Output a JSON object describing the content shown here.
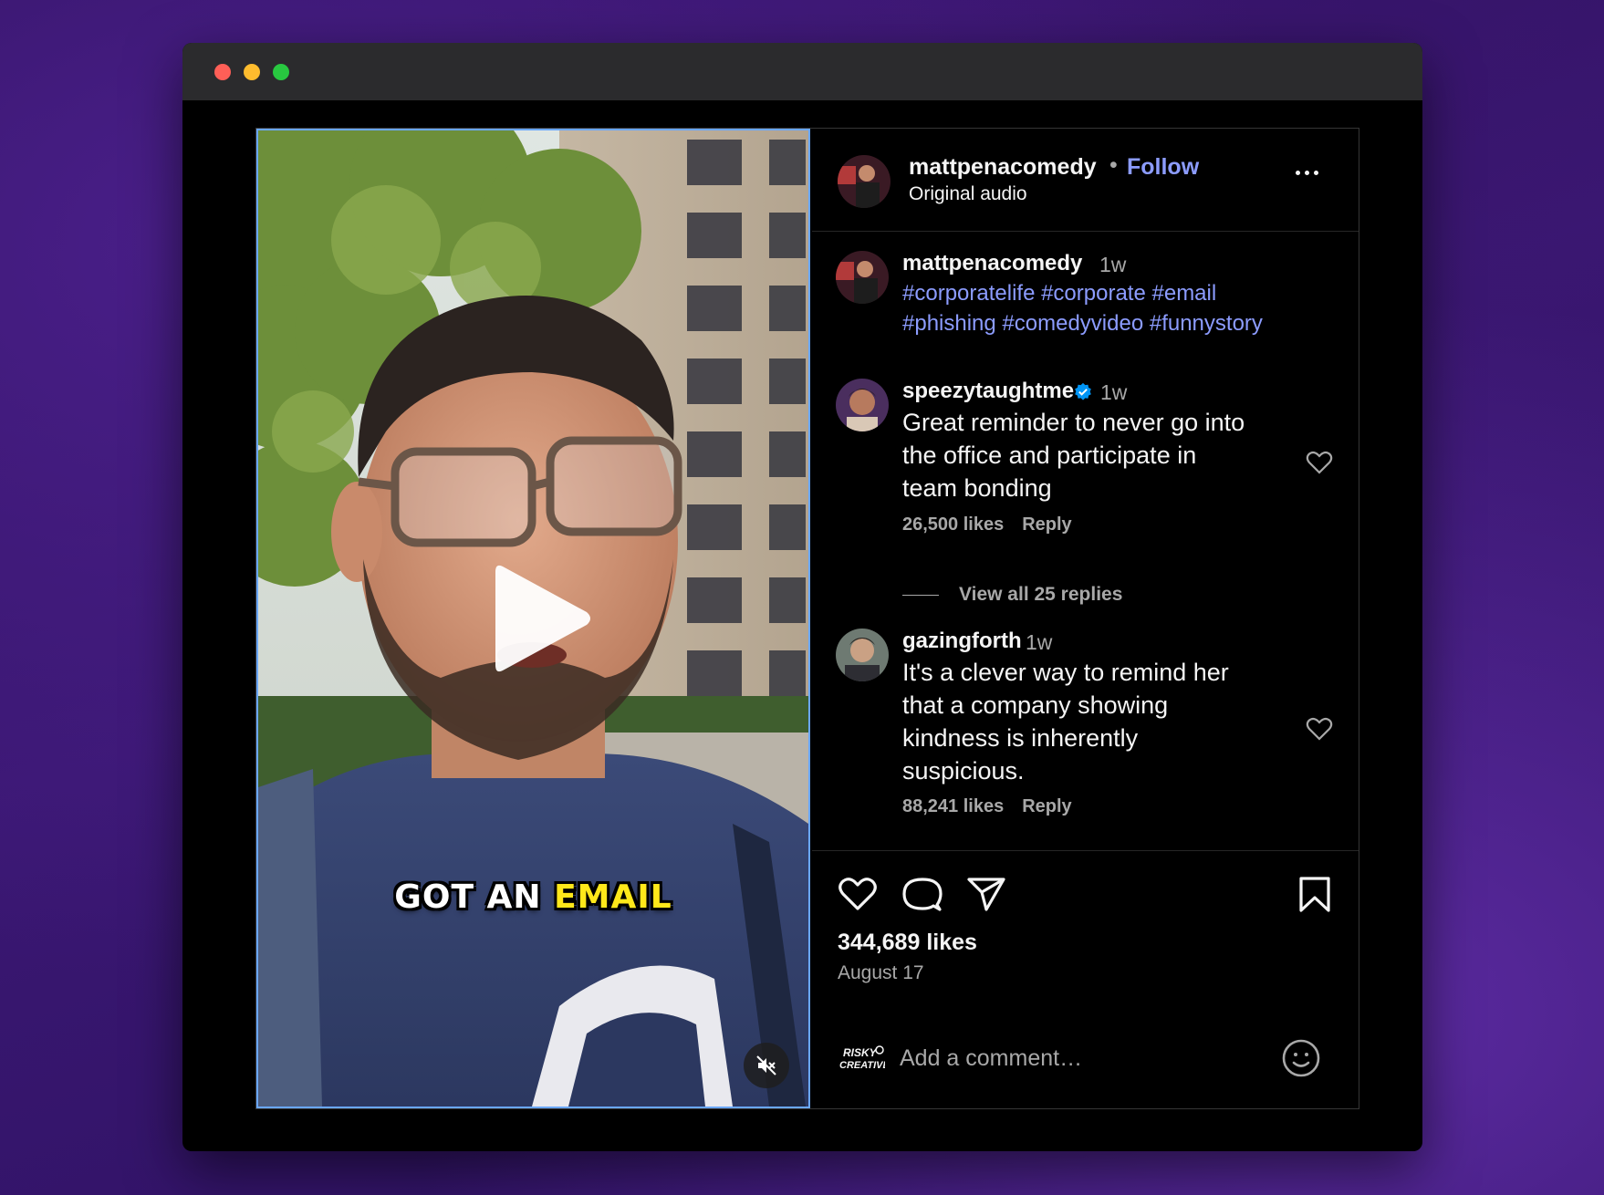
{
  "window": {
    "controls": [
      "close",
      "minimize",
      "maximize"
    ]
  },
  "video": {
    "caption_part1": "GOT AN ",
    "caption_part2": "EMAIL",
    "play_icon": "play-icon",
    "mute_icon": "mute-icon"
  },
  "header": {
    "username": "mattpenacomedy",
    "separator": "•",
    "follow_label": "Follow",
    "audio_label": "Original audio",
    "more_icon": "more-options-icon"
  },
  "caption_comment": {
    "username": "mattpenacomedy",
    "time": "1w",
    "hashtags_line1": "#corporatelife #corporate #email",
    "hashtags_line2": "#phishing #comedyvideo #funnystory"
  },
  "comments": [
    {
      "username": "speezytaughtme",
      "verified": true,
      "time": "1w",
      "text_lines": [
        "Great reminder to never go into",
        "the office and participate in",
        "team bonding"
      ],
      "likes": "26,500 likes",
      "reply_label": "Reply",
      "view_replies": "View all 25 replies"
    },
    {
      "username": "gazingforth",
      "verified": false,
      "time": "1w",
      "text_lines": [
        "It's a clever way to remind her",
        "that a company showing",
        "kindness is inherently",
        "suspicious."
      ],
      "likes": "88,241 likes",
      "reply_label": "Reply"
    }
  ],
  "actions": {
    "icons": [
      "heart-icon",
      "comment-icon",
      "share-icon",
      "bookmark-icon"
    ],
    "likes": "344,689 likes",
    "date": "August 17"
  },
  "add_comment": {
    "avatar_text_line1": "RISKY",
    "avatar_text_line2": "CREATIVE",
    "placeholder": "Add a comment…",
    "emoji_icon": "emoji-icon"
  },
  "colors": {
    "link": "#8c9cff",
    "muted": "#a8a8a8",
    "verified": "#0095f6",
    "caption_highlight": "#ffe81a"
  }
}
